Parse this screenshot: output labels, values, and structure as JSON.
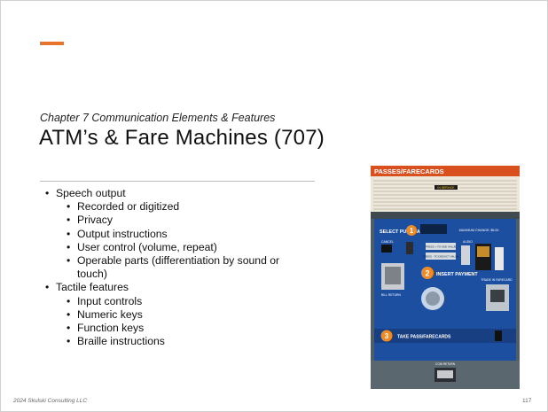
{
  "slide": {
    "accent_color": "#e8732a",
    "subtitle": "Chapter 7 Communication Elements & Features",
    "title": "ATM’s & Fare Machines (707)",
    "bullets": [
      {
        "text": "Speech output",
        "sub": [
          "Recorded or digitized",
          "Privacy",
          "Output instructions",
          "User control (volume, repeat)",
          "Operable parts (differentiation by sound or touch)"
        ]
      },
      {
        "text": "Tactile features",
        "sub": [
          "Input controls",
          "Numeric keys",
          "Function keys",
          "Braille instructions"
        ]
      }
    ],
    "footer": "2024 Skulski Consulting LLC",
    "page_number": "117"
  },
  "photo": {
    "header": "PASSES/FARECARDS",
    "service_label": "IN SERVICE",
    "step1": "SELECT PURCHASE",
    "step1_number": "1",
    "max_change": "MAXIMUM CHANGE: $5.00",
    "cancel": "CANCEL",
    "audio": "AUDIO",
    "press1": "PRESS + TO ADD VALUE",
    "press2": "PRESS - TO DEDUCT VALUE",
    "step2": "INSERT PAYMENT",
    "step2_number": "2",
    "bill_return": "BILL RETURN",
    "trade_in": "TRADE IN FARECARD",
    "step3": "TAKE PASS/FARECARDS",
    "step3_number": "3",
    "coin_return": "COIN RETURN"
  }
}
